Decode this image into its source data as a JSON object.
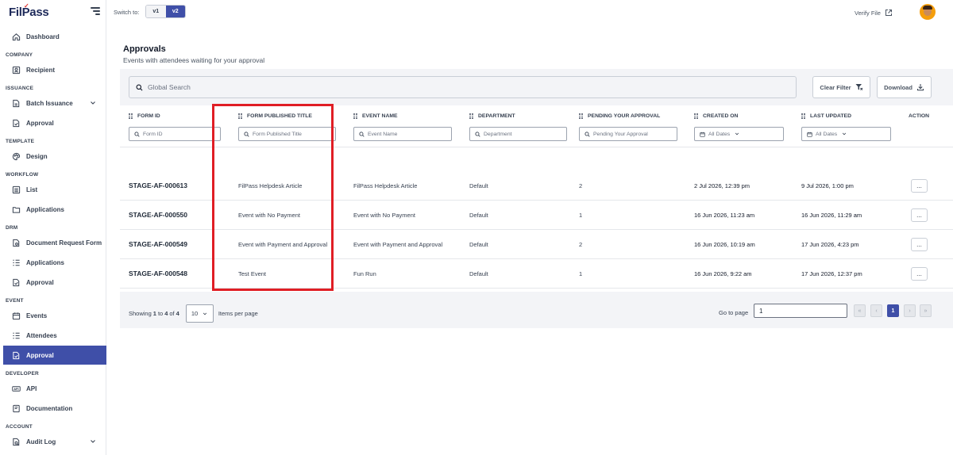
{
  "app": {
    "logo": "FilPass"
  },
  "topbar": {
    "switch_label": "Switch to:",
    "versions": [
      "v1",
      "v2"
    ],
    "active_version": "v2",
    "verify_label": "Verify File"
  },
  "sidebar": {
    "items": [
      {
        "section": "",
        "label": "Dashboard",
        "icon": "home-icon",
        "active": false
      },
      {
        "section": "COMPANY",
        "label": "Recipient",
        "icon": "user-box-icon",
        "active": false
      },
      {
        "section": "ISSUANCE",
        "label": "Batch Issuance",
        "icon": "batch-document-icon",
        "active": false,
        "expandable": true
      },
      {
        "section": "",
        "label": "Approval",
        "icon": "approval-document-icon",
        "active": false
      },
      {
        "section": "TEMPLATE",
        "label": "Design",
        "icon": "palette-icon",
        "active": false
      },
      {
        "section": "WORKFLOW",
        "label": "List",
        "icon": "list-icon",
        "active": false
      },
      {
        "section": "",
        "label": "Applications",
        "icon": "folder-icon",
        "active": false
      },
      {
        "section": "DRM",
        "label": "Document Request Form",
        "icon": "form-document-icon",
        "active": false
      },
      {
        "section": "",
        "label": "Applications",
        "icon": "checklist-icon",
        "active": false
      },
      {
        "section": "",
        "label": "Approval",
        "icon": "approval-document-icon",
        "active": false
      },
      {
        "section": "EVENT",
        "label": "Events",
        "icon": "calendar-icon",
        "active": false
      },
      {
        "section": "",
        "label": "Attendees",
        "icon": "checklist-icon",
        "active": false
      },
      {
        "section": "",
        "label": "Approval",
        "icon": "approval-document-icon",
        "active": true
      },
      {
        "section": "DEVELOPER",
        "label": "API",
        "icon": "api-icon",
        "active": false
      },
      {
        "section": "",
        "label": "Documentation",
        "icon": "book-icon",
        "active": false
      },
      {
        "section": "ACCOUNT",
        "label": "Audit Log",
        "icon": "audit-log-icon",
        "active": false,
        "expandable": true
      }
    ],
    "sections": [
      "COMPANY",
      "ISSUANCE",
      "TEMPLATE",
      "WORKFLOW",
      "DRM",
      "EVENT",
      "DEVELOPER",
      "ACCOUNT"
    ]
  },
  "main": {
    "title": "Approvals",
    "subtitle": "Events with attendees waiting for your approval",
    "search_placeholder": "Global Search",
    "clear_filter_label": "Clear Filter",
    "download_label": "Download"
  },
  "table": {
    "columns": [
      {
        "label": "FORM ID",
        "filter": "Form ID"
      },
      {
        "label": "FORM PUBLISHED TITLE",
        "filter": "Form Published Title"
      },
      {
        "label": "EVENT NAME",
        "filter": "Event Name"
      },
      {
        "label": "DEPARTMENT",
        "filter": "Department"
      },
      {
        "label": "PENDING YOUR APPROVAL",
        "filter": "Pending Your Approval"
      },
      {
        "label": "CREATED ON",
        "filter": "All Dates"
      },
      {
        "label": "LAST UPDATED",
        "filter": "All Dates"
      },
      {
        "label": "ACTION",
        "filter": ""
      }
    ],
    "rows": [
      {
        "form_id": "STAGE-AF-000613",
        "title": "FilPass Helpdesk Article",
        "event": "FilPass Helpdesk Article",
        "department": "Default",
        "pending": "2",
        "created": "2 Jul 2026, 12:39 pm",
        "updated": "9 Jul 2026, 1:00 pm",
        "action": "..."
      },
      {
        "form_id": "STAGE-AF-000550",
        "title": "Event with No Payment",
        "event": "Event with No Payment",
        "department": "Default",
        "pending": "1",
        "created": "16 Jun 2026, 11:23 am",
        "updated": "16 Jun 2026, 11:29 am",
        "action": "..."
      },
      {
        "form_id": "STAGE-AF-000549",
        "title": "Event with Payment and Approval",
        "event": "Event with Payment and Approval",
        "department": "Default",
        "pending": "2",
        "created": "16 Jun 2026, 10:19 am",
        "updated": "17 Jun 2026, 4:23 pm",
        "action": "..."
      },
      {
        "form_id": "STAGE-AF-000548",
        "title": "Test Event",
        "event": "Fun Run",
        "department": "Default",
        "pending": "1",
        "created": "16 Jun 2026, 9:22 am",
        "updated": "17 Jun 2026, 12:37 pm",
        "action": "..."
      }
    ]
  },
  "pagination": {
    "showing_prefix": "Showing",
    "from": "1",
    "to_word": "to",
    "to": "4",
    "of_word": "of",
    "total": "4",
    "per_page": "10",
    "per_page_label": "Items per page",
    "goto_label": "Go to page",
    "goto_value": "1",
    "first": "«",
    "prev": "‹",
    "current": "1",
    "next": "›",
    "last": "»"
  },
  "colors": {
    "accent": "#3f4fa8",
    "highlight": "#e01e25",
    "brand_check": "#e0322f"
  }
}
